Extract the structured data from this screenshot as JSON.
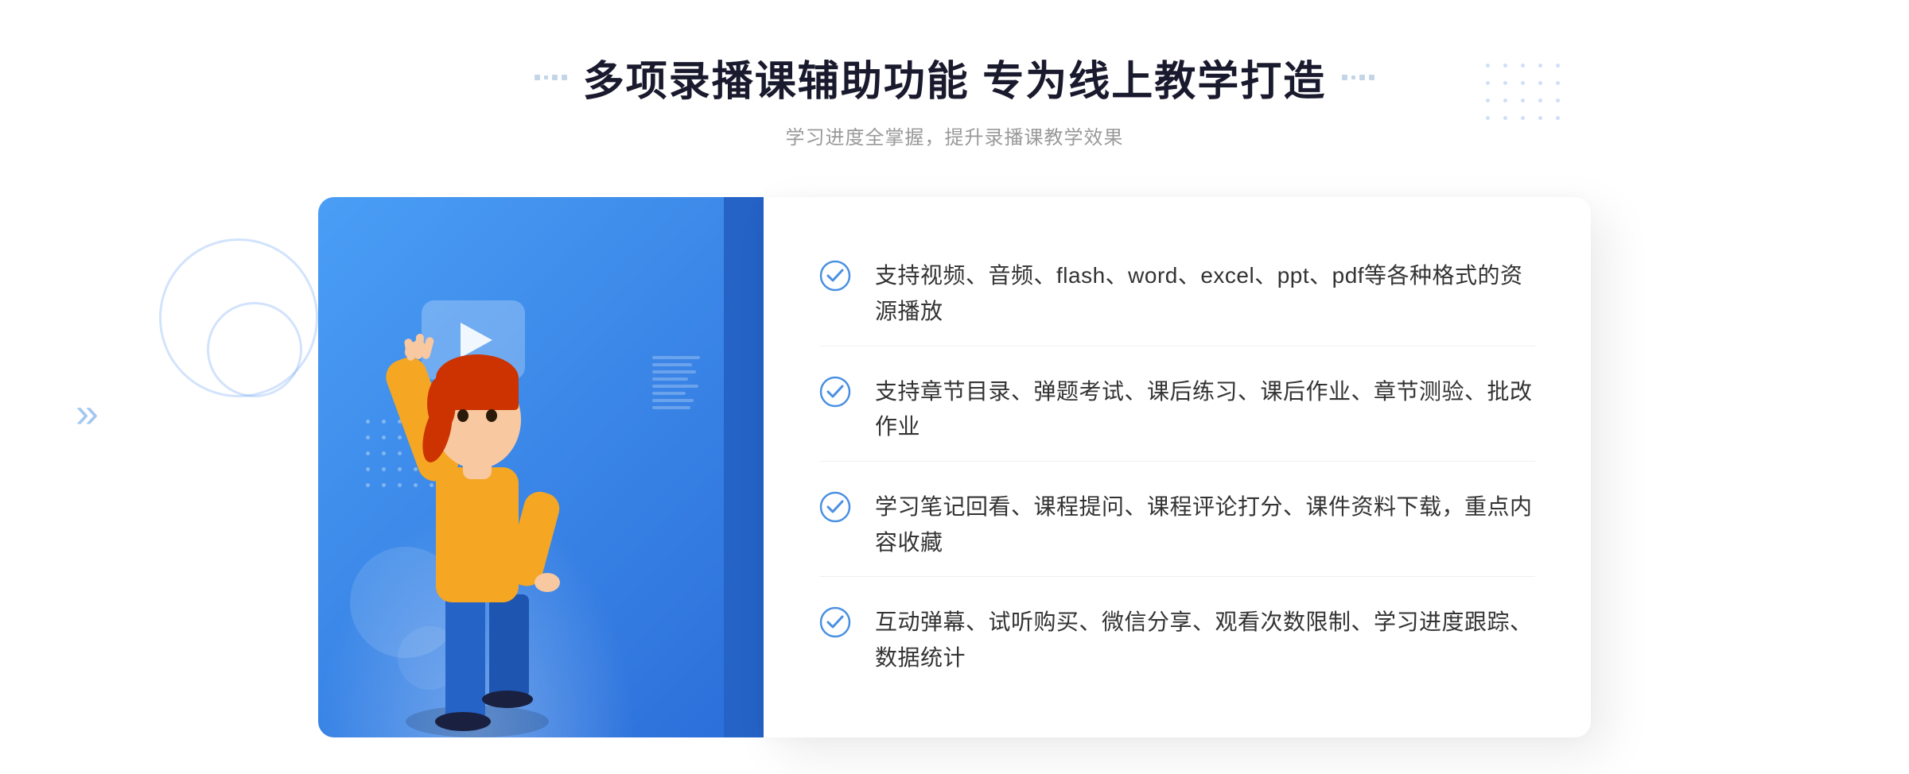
{
  "header": {
    "title": "多项录播课辅助功能 专为线上教学打造",
    "subtitle": "学习进度全掌握，提升录播课教学效果"
  },
  "features": [
    {
      "id": "feature-1",
      "text": "支持视频、音频、flash、word、excel、ppt、pdf等各种格式的资源播放"
    },
    {
      "id": "feature-2",
      "text": "支持章节目录、弹题考试、课后练习、课后作业、章节测验、批改作业"
    },
    {
      "id": "feature-3",
      "text": "学习笔记回看、课程提问、课程评论打分、课件资料下载，重点内容收藏"
    },
    {
      "id": "feature-4",
      "text": "互动弹幕、试听购买、微信分享、观看次数限制、学习进度跟踪、数据统计"
    }
  ],
  "decoration": {
    "dbl_arrow": "»"
  }
}
